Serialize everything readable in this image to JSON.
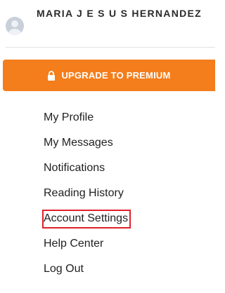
{
  "user": {
    "name": "MARIA J E S U S HERNANDEZ"
  },
  "upgrade": {
    "label": "UPGRADE TO PREMIUM",
    "icon": "lock-icon",
    "color": "#f47e1c"
  },
  "menu": {
    "items": [
      {
        "label": "My Profile",
        "highlighted": false
      },
      {
        "label": "My Messages",
        "highlighted": false
      },
      {
        "label": "Notifications",
        "highlighted": false
      },
      {
        "label": "Reading History",
        "highlighted": false
      },
      {
        "label": "Account Settings",
        "highlighted": true
      },
      {
        "label": "Help Center",
        "highlighted": false
      },
      {
        "label": "Log Out",
        "highlighted": false
      }
    ],
    "highlight_color": "#e0212b"
  }
}
